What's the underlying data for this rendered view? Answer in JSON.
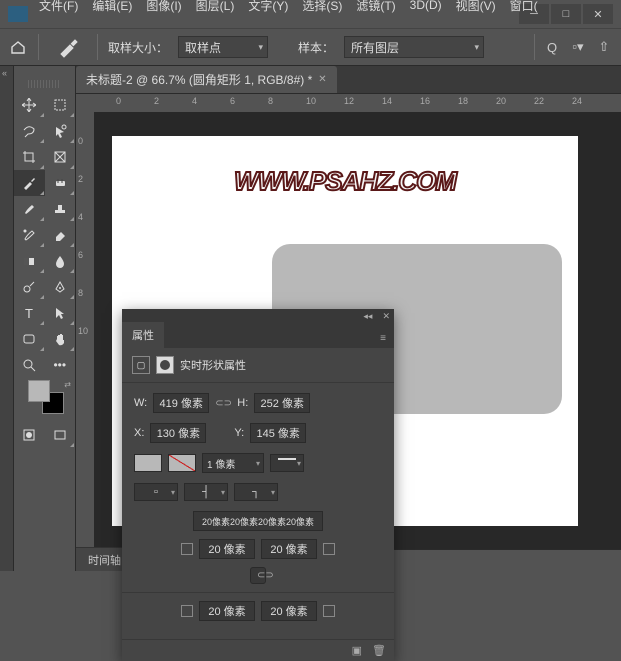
{
  "menu": [
    "文件(F)",
    "编辑(E)",
    "图像(I)",
    "图层(L)",
    "文字(Y)",
    "选择(S)",
    "滤镜(T)",
    "3D(D)",
    "视图(V)",
    "窗口("
  ],
  "options": {
    "sample_label": "取样大小：",
    "sample_value": "取样点",
    "scope_label": "样本：",
    "scope_value": "所有图层"
  },
  "doc": {
    "tab": "未标题-2 @ 66.7% (圆角矩形 1, RGB/8#) *",
    "zoom": "66.67%",
    "watermark": "WWW.PSAHZ.COM"
  },
  "rulerH": [
    "0",
    "2",
    "4",
    "6",
    "8",
    "10",
    "12",
    "14",
    "16",
    "18",
    "20",
    "22",
    "24"
  ],
  "rulerV": [
    "0",
    "2",
    "4",
    "6",
    "8",
    "10"
  ],
  "timeline": "时间轴",
  "panel": {
    "title": "属性",
    "subtitle": "实时形状属性",
    "W": "W:",
    "Wv": "419 像素",
    "H": "H:",
    "Hv": "252 像素",
    "X": "X:",
    "Xv": "130 像素",
    "Y": "Y:",
    "Yv": "145 像素",
    "stroke": "1 像素",
    "cornersAll": "20像素20像素20像素20像素",
    "c1": "20 像素",
    "c2": "20 像素",
    "c3": "20 像素",
    "c4": "20 像素"
  }
}
